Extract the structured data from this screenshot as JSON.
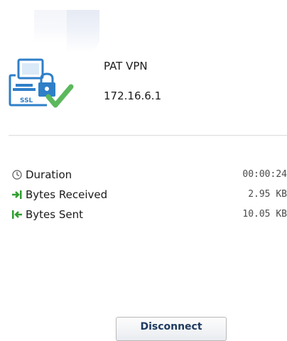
{
  "connection": {
    "name": "PAT VPN",
    "ip": "172.16.6.1",
    "icon": "ssl-vpn-connected-icon",
    "badge_text": "SSL"
  },
  "stats": [
    {
      "icon": "clock-icon",
      "label": "Duration",
      "value": "00:00:24"
    },
    {
      "icon": "arrow-in-icon",
      "label": "Bytes Received",
      "value": "2.95 KB"
    },
    {
      "icon": "arrow-out-icon",
      "label": "Bytes Sent",
      "value": "10.05 KB"
    }
  ],
  "actions": {
    "disconnect_label": "Disconnect"
  },
  "colors": {
    "accent_blue": "#2f7fc8",
    "check_green": "#5cb85c",
    "arrow_green": "#2e9e2e"
  }
}
